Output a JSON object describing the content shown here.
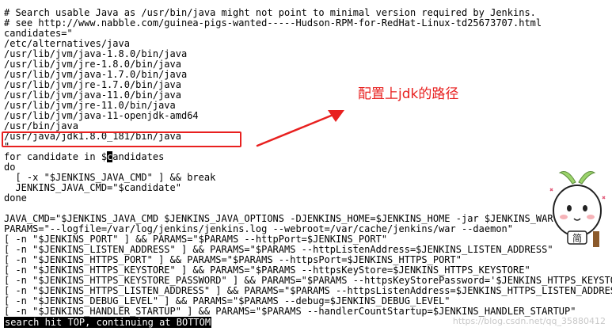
{
  "terminal": {
    "lines": [
      "# Search usable Java as /usr/bin/java might not point to minimal version required by Jenkins.",
      "# see http://www.nabble.com/guinea-pigs-wanted-----Hudson-RPM-for-RedHat-Linux-td25673707.html",
      "candidates=\"",
      "/etc/alternatives/java",
      "/usr/lib/jvm/java-1.8.0/bin/java",
      "/usr/lib/jvm/jre-1.8.0/bin/java",
      "/usr/lib/jvm/java-1.7.0/bin/java",
      "/usr/lib/jvm/jre-1.7.0/bin/java",
      "/usr/lib/jvm/java-11.0/bin/java",
      "/usr/lib/jvm/jre-11.0/bin/java",
      "/usr/lib/jvm/java-11-openjdk-amd64",
      "/usr/bin/java",
      "/usr/java/jdk1.8.0_181/bin/java",
      "\"",
      "for candidate in $candidates",
      "do",
      "  [ -x \"$JENKINS_JAVA_CMD\" ] && break",
      "  JENKINS_JAVA_CMD=\"$candidate\"",
      "done",
      "",
      "JAVA_CMD=\"$JENKINS_JAVA_CMD $JENKINS_JAVA_OPTIONS -DJENKINS_HOME=$JENKINS_HOME -jar $JENKINS_WAR\"",
      "PARAMS=\"--logfile=/var/log/jenkins/jenkins.log --webroot=/var/cache/jenkins/war --daemon\"",
      "[ -n \"$JENKINS_PORT\" ] && PARAMS=\"$PARAMS --httpPort=$JENKINS_PORT\"",
      "[ -n \"$JENKINS_LISTEN_ADDRESS\" ] && PARAMS=\"$PARAMS --httpListenAddress=$JENKINS_LISTEN_ADDRESS\"",
      "[ -n \"$JENKINS_HTTPS_PORT\" ] && PARAMS=\"$PARAMS --httpsPort=$JENKINS_HTTPS_PORT\"",
      "[ -n \"$JENKINS_HTTPS_KEYSTORE\" ] && PARAMS=\"$PARAMS --httpsKeyStore=$JENKINS_HTTPS_KEYSTORE\"",
      "[ -n \"$JENKINS_HTTPS_KEYSTORE_PASSWORD\" ] && PARAMS=\"$PARAMS --httpsKeyStorePassword='$JENKINS_HTTPS_KEYSTORE_PASSWORD'\"",
      "[ -n \"$JENKINS_HTTPS_LISTEN_ADDRESS\" ] && PARAMS=\"$PARAMS --httpsListenAddress=$JENKINS_HTTPS_LISTEN_ADDRESS\"",
      "[ -n \"$JENKINS_DEBUG_LEVEL\" ] && PARAMS=\"$PARAMS --debug=$JENKINS_DEBUG_LEVEL\"",
      "[ -n \"$JENKINS_HANDLER_STARTUP\" ] && PARAMS=\"$PARAMS --handlerCountStartup=$JENKINS_HANDLER_STARTUP\""
    ],
    "for_line": {
      "prefix": "for candidate in $",
      "cursor_char": "c",
      "suffix": "andidates"
    },
    "status_message": "search hit TOP, continuing at BOTTOM"
  },
  "annotation": {
    "text": "配置上jdk的路径",
    "color": "#e8201f"
  },
  "sticker": {
    "text": "简"
  },
  "watermark": {
    "text": "https://blog.csdn.net/qq_35880412"
  },
  "colors": {
    "annotation_red": "#e8201f",
    "terminal_bg": "#ffffff",
    "terminal_fg": "#000000"
  }
}
